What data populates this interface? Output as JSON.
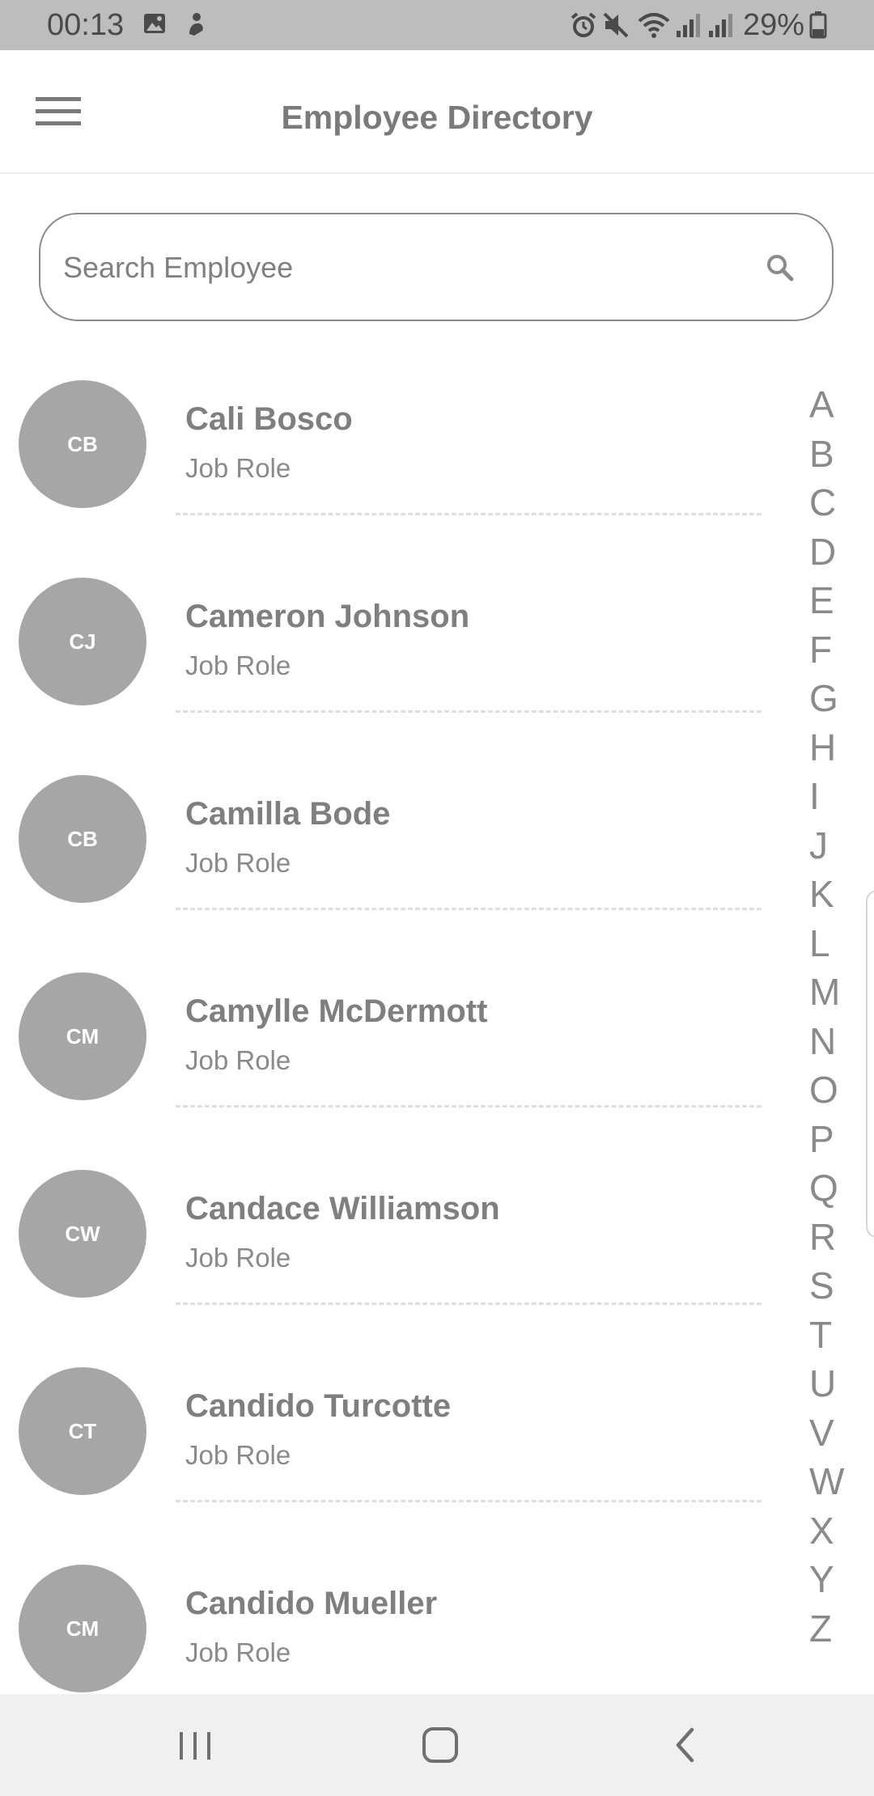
{
  "status_bar": {
    "time": "00:13",
    "battery": "29%",
    "icons": [
      "gallery-icon",
      "app-notification-icon",
      "alarm-icon",
      "mute-icon",
      "wifi-icon",
      "signal-icon",
      "signal-icon",
      "battery-icon"
    ]
  },
  "app_bar": {
    "title": "Employee Directory",
    "menu_icon": "hamburger-menu-icon"
  },
  "search": {
    "placeholder": "Search Employee",
    "value": "",
    "icon": "search-icon"
  },
  "employees": [
    {
      "initials": "CB",
      "name": "Cali Bosco",
      "role": "Job Role"
    },
    {
      "initials": "CJ",
      "name": "Cameron Johnson",
      "role": "Job Role"
    },
    {
      "initials": "CB",
      "name": "Camilla Bode",
      "role": "Job Role"
    },
    {
      "initials": "CM",
      "name": "Camylle McDermott",
      "role": "Job Role"
    },
    {
      "initials": "CW",
      "name": "Candace Williamson",
      "role": "Job Role"
    },
    {
      "initials": "CT",
      "name": "Candido Turcotte",
      "role": "Job Role"
    },
    {
      "initials": "CM",
      "name": "Candido Mueller",
      "role": "Job Role"
    }
  ],
  "alphabet_index": [
    "A",
    "B",
    "C",
    "D",
    "E",
    "F",
    "G",
    "H",
    "I",
    "J",
    "K",
    "L",
    "M",
    "N",
    "O",
    "P",
    "Q",
    "R",
    "S",
    "T",
    "U",
    "V",
    "W",
    "X",
    "Y",
    "Z"
  ],
  "colors": {
    "avatar_bg": "#a6a6a6",
    "status_bar_bg": "#bdbdbd",
    "text_gray": "#808080",
    "nav_bar_bg": "#f0f0f0"
  },
  "nav_bar": {
    "recents_icon": "recent-apps-icon",
    "home_icon": "home-icon",
    "back_icon": "back-icon"
  }
}
